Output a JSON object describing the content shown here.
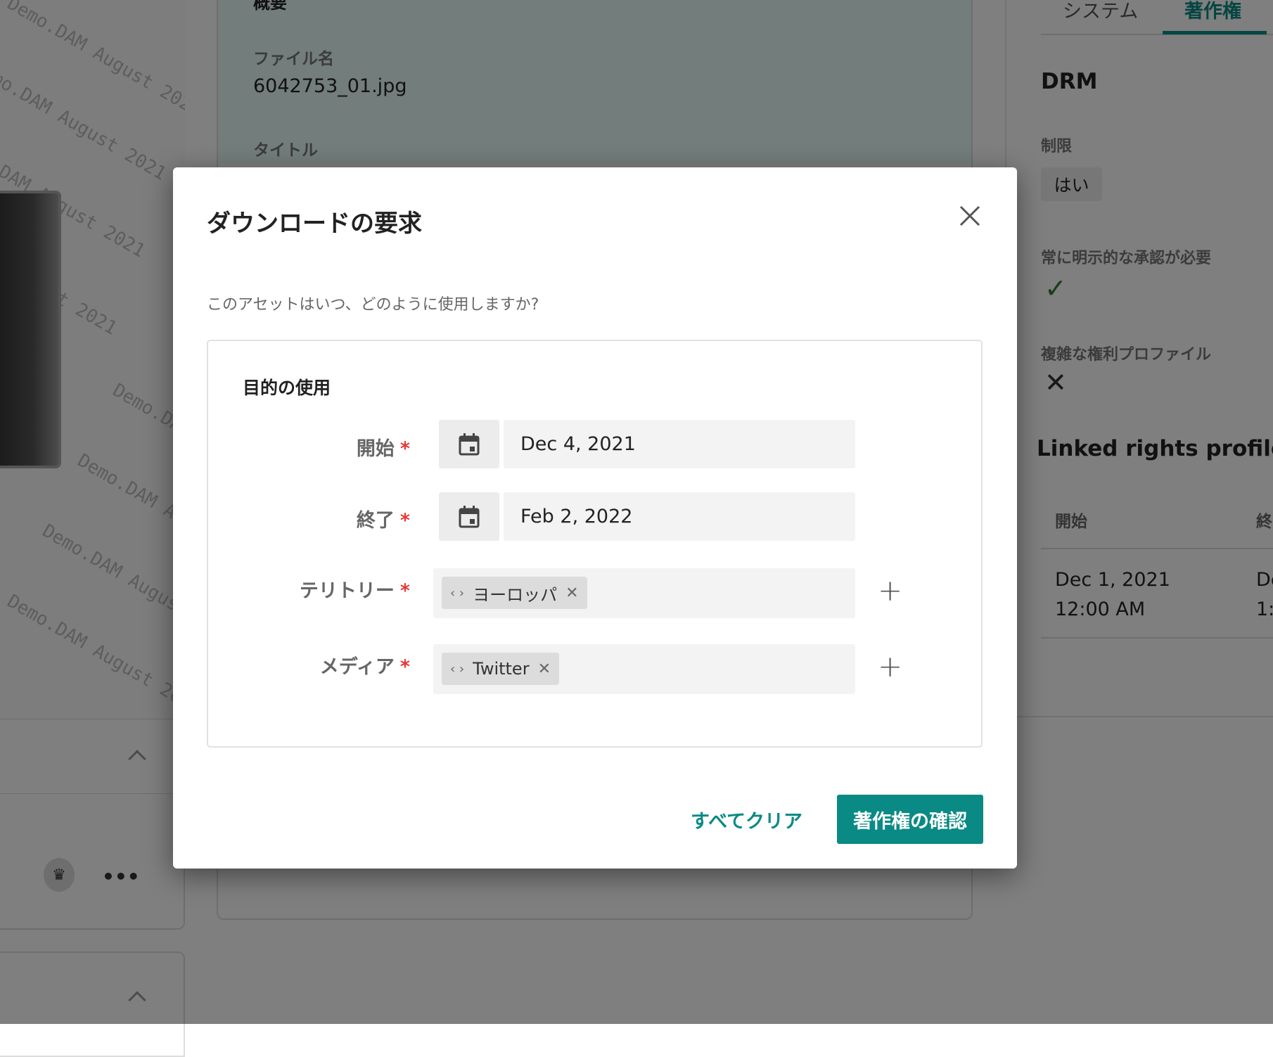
{
  "background": {
    "watermark": "Demo.DAM August 2021",
    "overview": {
      "heading": "概要",
      "filename_label": "ファイル名",
      "filename_value": "6042753_01.jpg",
      "title_label": "タイトル"
    },
    "right_panel": {
      "tabs": [
        {
          "label": "システム",
          "active": false
        },
        {
          "label": "著作権",
          "active": true
        }
      ],
      "drm_heading": "DRM",
      "restriction_label": "制限",
      "restriction_value": "はい",
      "explicit_approval_label": "常に明示的な承認が必要",
      "explicit_approval_value": "check-icon",
      "complex_profile_label": "複雑な権利プロファイル",
      "complex_profile_value": "x-icon",
      "linked_heading": "Linked rights profiles",
      "table_headers": [
        "開始",
        "終"
      ],
      "table_rows": [
        [
          "Dec 1, 2021\n12:00 AM",
          "De\n1:"
        ]
      ]
    }
  },
  "dialog": {
    "title": "ダウンロードの要求",
    "subtitle": "このアセットはいつ、どのように使用しますか?",
    "section_title": "目的の使用",
    "required_mark": "*",
    "start": {
      "label": "開始",
      "value": "Dec 4, 2021"
    },
    "end": {
      "label": "終了",
      "value": "Feb 2, 2022"
    },
    "territory": {
      "label": "テリトリー",
      "tags": [
        "ヨーロッパ"
      ]
    },
    "media": {
      "label": "メディア",
      "tags": [
        "Twitter"
      ]
    },
    "clear_all": "すべてクリア",
    "confirm": "著作権の確認"
  },
  "colors": {
    "accent": "#0a8a84",
    "required": "#e53935",
    "check": "#2e7d32"
  }
}
